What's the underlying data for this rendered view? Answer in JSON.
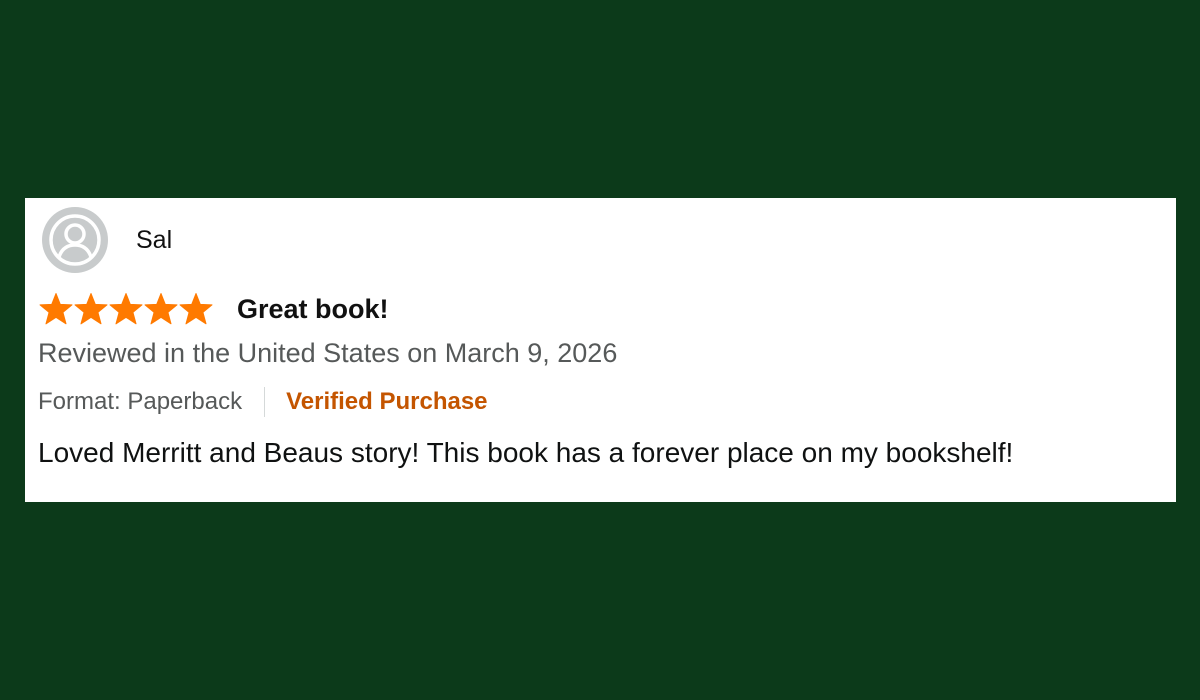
{
  "review": {
    "reviewer_name": "Sal",
    "avatar_icon": "person-silhouette-icon",
    "rating": 5,
    "rating_max": 5,
    "star_color": "#ff7a00",
    "title": "Great book!",
    "meta": "Reviewed in the United States on March 9, 2026",
    "format": "Format: Paperback",
    "verified_label": "Verified Purchase",
    "verified_color": "#c45500",
    "body": "Loved Merritt and Beaus story! This book has a forever place on my bookshelf!"
  },
  "colors": {
    "background": "#0c3a1a",
    "card": "#ffffff"
  }
}
